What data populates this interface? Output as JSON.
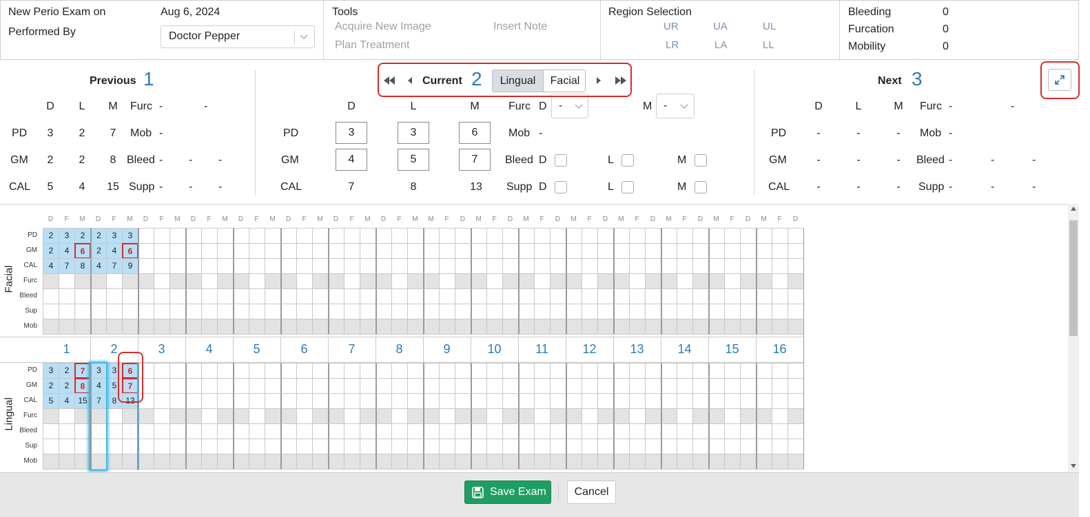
{
  "header": {
    "exam_label": "New Perio Exam on",
    "exam_date": "Aug 6, 2024",
    "performed_by_label": "Performed By",
    "doctor": "Doctor Pepper",
    "tools_label": "Tools",
    "tools": [
      "Acquire New Image",
      "Insert Note",
      "Plan Treatment"
    ],
    "region_label": "Region Selection",
    "regions": [
      "UR",
      "UA",
      "UL",
      "LR",
      "LA",
      "LL"
    ],
    "stats": [
      {
        "label": "Bleeding",
        "value": "0"
      },
      {
        "label": "Furcation",
        "value": "0"
      },
      {
        "label": "Mobility",
        "value": "0"
      }
    ]
  },
  "previous": {
    "title": "Previous",
    "number": "1",
    "cols": [
      "D",
      "L",
      "M"
    ],
    "furc_label": "Furc",
    "furc": [
      "-",
      "-"
    ],
    "rows": [
      {
        "label": "PD",
        "values": [
          "3",
          "2",
          "7"
        ],
        "extra_label": "Mob",
        "extra": [
          "-"
        ]
      },
      {
        "label": "GM",
        "values": [
          "2",
          "2",
          "8"
        ],
        "extra_label": "Bleed",
        "extra": [
          "-",
          "-",
          "-"
        ]
      },
      {
        "label": "CAL",
        "values": [
          "5",
          "4",
          "15"
        ],
        "extra_label": "Supp",
        "extra": [
          "-",
          "-",
          "-"
        ]
      }
    ]
  },
  "current": {
    "title": "Current",
    "number": "2",
    "toggle": [
      "Lingual",
      "Facial"
    ],
    "cols": [
      "D",
      "L",
      "M"
    ],
    "furc_label": "Furc",
    "furc_d_label": "D",
    "furc_m_label": "M",
    "dash": "-",
    "pd_label": "PD",
    "pd": [
      "3",
      "3",
      "6"
    ],
    "mob_label": "Mob",
    "mob": "-",
    "gm_label": "GM",
    "gm": [
      "4",
      "5",
      "7"
    ],
    "bleed_label": "Bleed",
    "cal_label": "CAL",
    "cal": [
      "7",
      "8",
      "13"
    ],
    "supp_label": "Supp",
    "check_labels": [
      "D",
      "L",
      "M"
    ]
  },
  "next": {
    "title": "Next",
    "number": "3",
    "cols": [
      "D",
      "L",
      "M"
    ],
    "furc_label": "Furc",
    "furc": [
      "-",
      "-"
    ],
    "rows": [
      {
        "label": "PD",
        "values": [
          "-",
          "-",
          "-"
        ],
        "extra_label": "Mob",
        "extra": [
          "-"
        ]
      },
      {
        "label": "GM",
        "values": [
          "-",
          "-",
          "-"
        ],
        "extra_label": "Bleed",
        "extra": [
          "-",
          "-",
          "-"
        ]
      },
      {
        "label": "CAL",
        "values": [
          "-",
          "-",
          "-"
        ],
        "extra_label": "Supp",
        "extra": [
          "-",
          "-",
          "-"
        ]
      }
    ]
  },
  "chart": {
    "facial_label": "Facial",
    "lingual_label": "Lingual",
    "facial_rows": [
      "PD",
      "GM",
      "CAL",
      "Furc",
      "Bleed",
      "Sup",
      "Mob"
    ],
    "lingual_rows": [
      "PD",
      "GM",
      "CAL",
      "Furc",
      "Bleed",
      "Sup",
      "Mob"
    ],
    "col_headers": [
      "D",
      "F",
      "M",
      "D",
      "F",
      "M",
      "D",
      "F",
      "M",
      "D",
      "F",
      "M",
      "D",
      "F",
      "M",
      "D",
      "F",
      "M",
      "D",
      "F",
      "M",
      "D",
      "F",
      "M",
      "M",
      "F",
      "D",
      "M",
      "F",
      "D",
      "M",
      "F",
      "D",
      "M",
      "F",
      "D",
      "M",
      "F",
      "D",
      "M",
      "F",
      "D",
      "M",
      "F",
      "D",
      "M",
      "F",
      "D"
    ],
    "teeth": [
      "1",
      "2",
      "3",
      "4",
      "5",
      "6",
      "7",
      "8",
      "9",
      "10",
      "11",
      "12",
      "13",
      "14",
      "15",
      "16"
    ],
    "facial_values": {
      "PD": [
        "2",
        "3",
        "2",
        "2",
        "3",
        "3"
      ],
      "GM": [
        "2",
        "4",
        "6",
        "2",
        "4",
        "6"
      ],
      "CAL": [
        "4",
        "7",
        "8",
        "4",
        "7",
        "9"
      ]
    },
    "lingual_values": {
      "PD": [
        "3",
        "2",
        "7",
        "3",
        "3",
        "6"
      ],
      "GM": [
        "2",
        "2",
        "8",
        "4",
        "5",
        "7"
      ],
      "CAL": [
        "5",
        "4",
        "15",
        "7",
        "8",
        "13"
      ]
    }
  },
  "footer": {
    "save_label": "Save Exam",
    "cancel_label": "Cancel"
  },
  "colors": {
    "accent": "#2e7bb5",
    "highlight_red": "#d62b2b",
    "cell_blue": "#b8dff5",
    "save_green": "#1e9e64"
  }
}
